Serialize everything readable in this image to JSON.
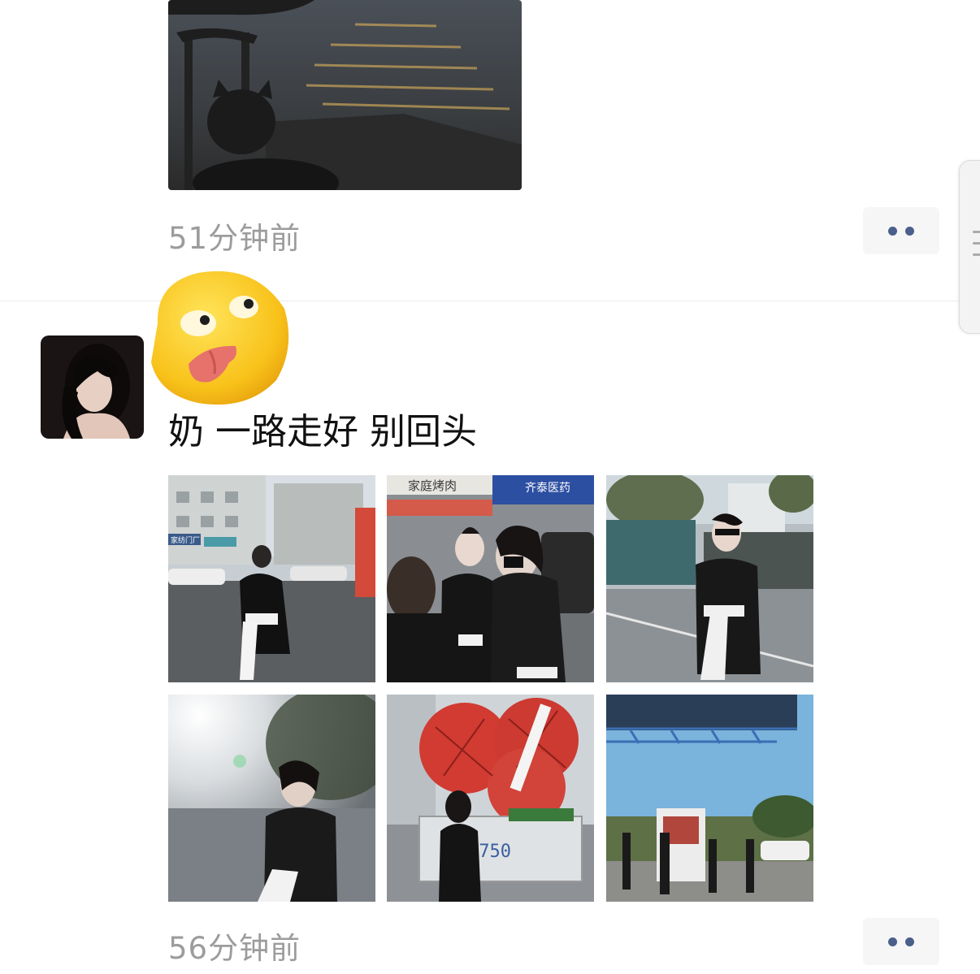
{
  "top_post": {
    "timestamp": "51分钟前",
    "more_label": "more-options"
  },
  "post": {
    "text": "奶 一路走好 别回头",
    "timestamp": "56分钟前",
    "photo_signs": {
      "shop_sign_1": "家庭烤肉",
      "shop_sign_2": "齐泰医药",
      "small_sign": "家纺门厂"
    }
  },
  "colors": {
    "link_blue": "#4a5f8a",
    "timestamp_gray": "#9c9c9c",
    "more_bg": "#f6f6f6"
  },
  "icons": {
    "more": "more-dots-icon",
    "emoji": "tongue-out-emoji-icon",
    "side": "side-handle-icon"
  }
}
